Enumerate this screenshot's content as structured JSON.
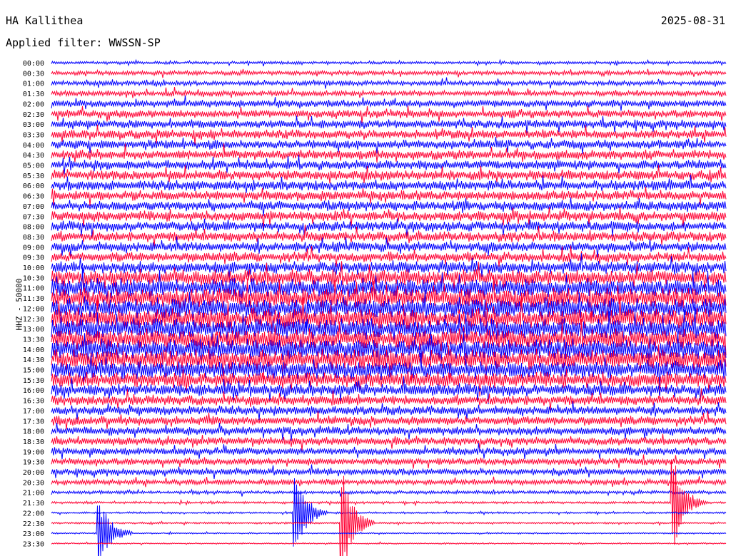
{
  "header": {
    "station": "HA Kallithea",
    "filter": "Applied filter: WWSSN-SP",
    "date": "2025-08-31"
  },
  "chart_data": {
    "type": "line",
    "title": "HA Kallithea",
    "ylabel": "HHZ - 50000",
    "row_labels": [
      "00:00",
      "00:30",
      "01:00",
      "01:30",
      "02:00",
      "02:30",
      "03:00",
      "03:30",
      "04:00",
      "04:30",
      "05:00",
      "05:30",
      "06:00",
      "06:30",
      "07:00",
      "07:30",
      "08:00",
      "08:30",
      "09:00",
      "09:30",
      "10:00",
      "10:30",
      "11:00",
      "11:30",
      "12:00",
      "12:30",
      "13:00",
      "13:30",
      "14:00",
      "14:30",
      "15:00",
      "15:30",
      "16:00",
      "16:30",
      "17:00",
      "17:30",
      "18:00",
      "18:30",
      "19:00",
      "19:30",
      "20:00",
      "20:30",
      "21:00",
      "21:30",
      "22:00",
      "22:30",
      "23:00",
      "23:30"
    ],
    "trace_colors": [
      "#0000ff",
      "#ff0033"
    ],
    "row_amplitude": [
      0.3,
      0.45,
      0.5,
      0.55,
      0.7,
      0.8,
      0.85,
      0.9,
      0.9,
      0.95,
      0.95,
      1.0,
      1.0,
      1.0,
      1.0,
      1.0,
      1.0,
      1.0,
      1.0,
      1.0,
      1.2,
      1.6,
      1.8,
      1.9,
      2.0,
      2.0,
      2.0,
      2.0,
      2.0,
      2.0,
      1.8,
      1.5,
      1.2,
      1.0,
      0.9,
      0.9,
      0.85,
      0.8,
      0.75,
      0.7,
      0.65,
      0.55,
      0.35,
      0.25,
      0.2,
      0.2,
      0.15,
      0.15
    ],
    "events": [
      {
        "time": "23:00",
        "x_fraction": 0.07,
        "amplitude": 4
      },
      {
        "time": "22:00",
        "x_fraction": 0.36,
        "amplitude": 5
      },
      {
        "time": "22:30",
        "x_fraction": 0.43,
        "amplitude": 6
      },
      {
        "time": "21:30",
        "x_fraction": 0.92,
        "amplitude": 5
      }
    ]
  }
}
